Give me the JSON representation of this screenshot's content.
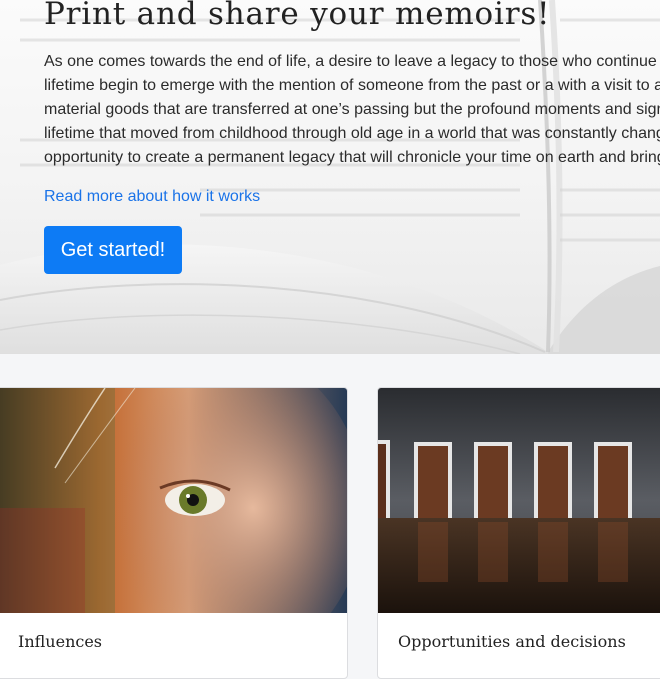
{
  "hero": {
    "title": "Print and share your memoirs!",
    "paragraph_lines": [
      "As one comes towards the end of life, a desire to leave a legacy to those who continue",
      "lifetime begin to emerge with the mention of someone from the past or a with a visit to a",
      "material goods that are transferred at one’s passing but the profound moments and sign",
      "lifetime that moved from childhood through old age in a world that was constantly chang",
      "opportunity to create a permanent legacy that will chronicle your time on earth and bring"
    ],
    "read_more_link": "Read more about how it works",
    "cta_button": "Get started!"
  },
  "cards": [
    {
      "title": "Influences",
      "image": "child-eye-closeup"
    },
    {
      "title": "Opportunities and decisions",
      "image": "row-of-doors"
    }
  ],
  "colors": {
    "link": "#1a73e8",
    "button_bg": "#0d7bf5",
    "button_text": "#ffffff",
    "section_bg": "#f5f6f8"
  }
}
